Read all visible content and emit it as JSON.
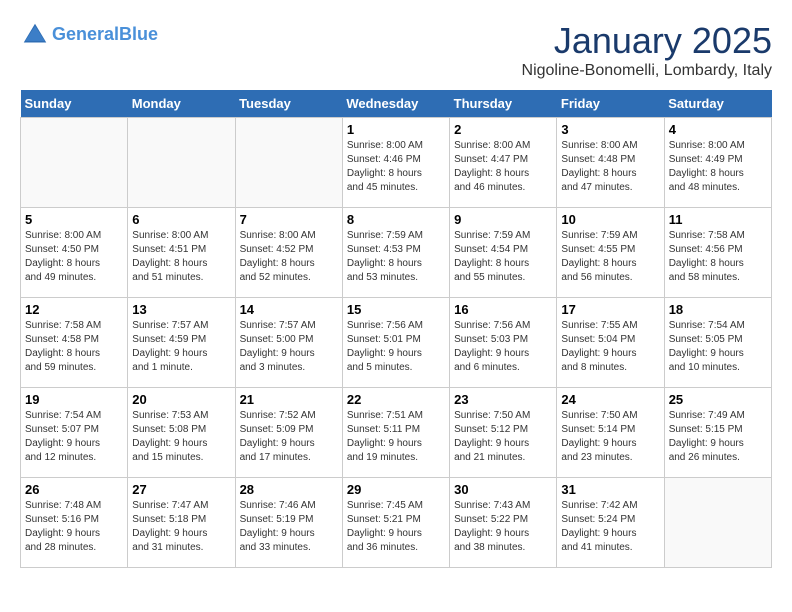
{
  "header": {
    "logo_line1": "General",
    "logo_line2": "Blue",
    "title": "January 2025",
    "subtitle": "Nigoline-Bonomelli, Lombardy, Italy"
  },
  "days_of_week": [
    "Sunday",
    "Monday",
    "Tuesday",
    "Wednesday",
    "Thursday",
    "Friday",
    "Saturday"
  ],
  "weeks": [
    [
      {
        "day": "",
        "info": ""
      },
      {
        "day": "",
        "info": ""
      },
      {
        "day": "",
        "info": ""
      },
      {
        "day": "1",
        "info": "Sunrise: 8:00 AM\nSunset: 4:46 PM\nDaylight: 8 hours\nand 45 minutes."
      },
      {
        "day": "2",
        "info": "Sunrise: 8:00 AM\nSunset: 4:47 PM\nDaylight: 8 hours\nand 46 minutes."
      },
      {
        "day": "3",
        "info": "Sunrise: 8:00 AM\nSunset: 4:48 PM\nDaylight: 8 hours\nand 47 minutes."
      },
      {
        "day": "4",
        "info": "Sunrise: 8:00 AM\nSunset: 4:49 PM\nDaylight: 8 hours\nand 48 minutes."
      }
    ],
    [
      {
        "day": "5",
        "info": "Sunrise: 8:00 AM\nSunset: 4:50 PM\nDaylight: 8 hours\nand 49 minutes."
      },
      {
        "day": "6",
        "info": "Sunrise: 8:00 AM\nSunset: 4:51 PM\nDaylight: 8 hours\nand 51 minutes."
      },
      {
        "day": "7",
        "info": "Sunrise: 8:00 AM\nSunset: 4:52 PM\nDaylight: 8 hours\nand 52 minutes."
      },
      {
        "day": "8",
        "info": "Sunrise: 7:59 AM\nSunset: 4:53 PM\nDaylight: 8 hours\nand 53 minutes."
      },
      {
        "day": "9",
        "info": "Sunrise: 7:59 AM\nSunset: 4:54 PM\nDaylight: 8 hours\nand 55 minutes."
      },
      {
        "day": "10",
        "info": "Sunrise: 7:59 AM\nSunset: 4:55 PM\nDaylight: 8 hours\nand 56 minutes."
      },
      {
        "day": "11",
        "info": "Sunrise: 7:58 AM\nSunset: 4:56 PM\nDaylight: 8 hours\nand 58 minutes."
      }
    ],
    [
      {
        "day": "12",
        "info": "Sunrise: 7:58 AM\nSunset: 4:58 PM\nDaylight: 8 hours\nand 59 minutes."
      },
      {
        "day": "13",
        "info": "Sunrise: 7:57 AM\nSunset: 4:59 PM\nDaylight: 9 hours\nand 1 minute."
      },
      {
        "day": "14",
        "info": "Sunrise: 7:57 AM\nSunset: 5:00 PM\nDaylight: 9 hours\nand 3 minutes."
      },
      {
        "day": "15",
        "info": "Sunrise: 7:56 AM\nSunset: 5:01 PM\nDaylight: 9 hours\nand 5 minutes."
      },
      {
        "day": "16",
        "info": "Sunrise: 7:56 AM\nSunset: 5:03 PM\nDaylight: 9 hours\nand 6 minutes."
      },
      {
        "day": "17",
        "info": "Sunrise: 7:55 AM\nSunset: 5:04 PM\nDaylight: 9 hours\nand 8 minutes."
      },
      {
        "day": "18",
        "info": "Sunrise: 7:54 AM\nSunset: 5:05 PM\nDaylight: 9 hours\nand 10 minutes."
      }
    ],
    [
      {
        "day": "19",
        "info": "Sunrise: 7:54 AM\nSunset: 5:07 PM\nDaylight: 9 hours\nand 12 minutes."
      },
      {
        "day": "20",
        "info": "Sunrise: 7:53 AM\nSunset: 5:08 PM\nDaylight: 9 hours\nand 15 minutes."
      },
      {
        "day": "21",
        "info": "Sunrise: 7:52 AM\nSunset: 5:09 PM\nDaylight: 9 hours\nand 17 minutes."
      },
      {
        "day": "22",
        "info": "Sunrise: 7:51 AM\nSunset: 5:11 PM\nDaylight: 9 hours\nand 19 minutes."
      },
      {
        "day": "23",
        "info": "Sunrise: 7:50 AM\nSunset: 5:12 PM\nDaylight: 9 hours\nand 21 minutes."
      },
      {
        "day": "24",
        "info": "Sunrise: 7:50 AM\nSunset: 5:14 PM\nDaylight: 9 hours\nand 23 minutes."
      },
      {
        "day": "25",
        "info": "Sunrise: 7:49 AM\nSunset: 5:15 PM\nDaylight: 9 hours\nand 26 minutes."
      }
    ],
    [
      {
        "day": "26",
        "info": "Sunrise: 7:48 AM\nSunset: 5:16 PM\nDaylight: 9 hours\nand 28 minutes."
      },
      {
        "day": "27",
        "info": "Sunrise: 7:47 AM\nSunset: 5:18 PM\nDaylight: 9 hours\nand 31 minutes."
      },
      {
        "day": "28",
        "info": "Sunrise: 7:46 AM\nSunset: 5:19 PM\nDaylight: 9 hours\nand 33 minutes."
      },
      {
        "day": "29",
        "info": "Sunrise: 7:45 AM\nSunset: 5:21 PM\nDaylight: 9 hours\nand 36 minutes."
      },
      {
        "day": "30",
        "info": "Sunrise: 7:43 AM\nSunset: 5:22 PM\nDaylight: 9 hours\nand 38 minutes."
      },
      {
        "day": "31",
        "info": "Sunrise: 7:42 AM\nSunset: 5:24 PM\nDaylight: 9 hours\nand 41 minutes."
      },
      {
        "day": "",
        "info": ""
      }
    ]
  ]
}
